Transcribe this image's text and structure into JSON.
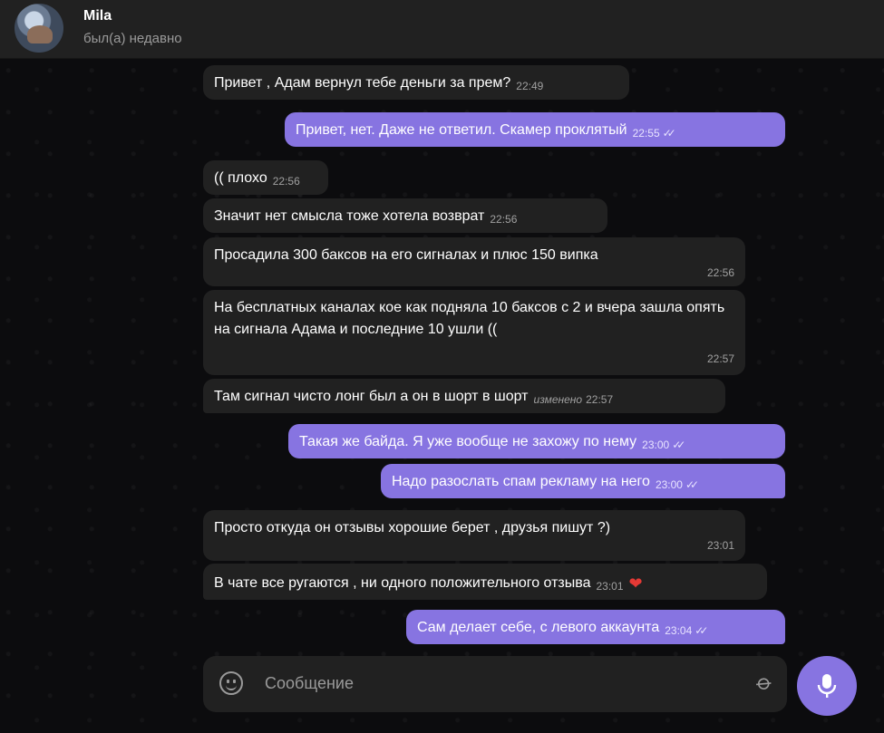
{
  "chat": {
    "name": "Mila",
    "status": "был(а) недавно"
  },
  "messages": [
    {
      "dir": "in",
      "text": "Привет , Адам вернул тебе деньги за прем?",
      "time": "22:49"
    },
    {
      "dir": "out",
      "text": "Привет, нет. Даже не ответил. Скамер проклятый",
      "time": "22:55",
      "read": true
    },
    {
      "dir": "in",
      "text": "(( плохо",
      "time": "22:56"
    },
    {
      "dir": "in",
      "text": "Значит нет смысла тоже хотела возврат",
      "time": "22:56"
    },
    {
      "dir": "in",
      "text": "Просадила 300 баксов на его сигналах и плюс 150 випка",
      "time": "22:56"
    },
    {
      "dir": "in",
      "text": "На бесплатных каналах кое как подняла 10 баксов с 2 и вчера зашла опять на сигнала Адама и последние 10  ушли ((",
      "time": "22:57"
    },
    {
      "dir": "in",
      "text": "Там сигнал чисто лонг был а он в шорт в шорт",
      "time": "22:57",
      "edited": "изменено"
    },
    {
      "dir": "out",
      "text": "Такая же байда. Я уже вообще не захожу по нему",
      "time": "23:00",
      "read": true
    },
    {
      "dir": "out",
      "text": "Надо разослать спам рекламу на него",
      "time": "23:00",
      "read": true
    },
    {
      "dir": "in",
      "text": "Просто откуда он отзывы хорошие берет , друзья пишут ?)",
      "time": "23:01"
    },
    {
      "dir": "in",
      "text": "В чате все ругаются , ни одного положительного отзыва",
      "time": "23:01",
      "reaction": "❤"
    },
    {
      "dir": "out",
      "text": "Сам делает себе, с левого аккаунта",
      "time": "23:04",
      "read": true
    }
  ],
  "composer": {
    "placeholder": "Сообщение",
    "emoji_icon": "emoji-icon",
    "attach_icon": "paperclip-icon",
    "send_icon": "microphone-icon"
  },
  "colors": {
    "accent": "#8774e1",
    "incoming_bubble": "#212121",
    "background": "#0c0c0e",
    "reaction": "#e53935"
  }
}
